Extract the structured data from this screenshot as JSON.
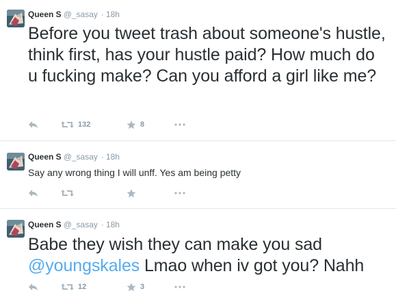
{
  "tweets": [
    {
      "fullname": "Queen S",
      "username": "@_sasay",
      "time": "18h",
      "text_before": "Before you tweet trash about someone's hustle, think first, has your hustle paid? How much do u fucking make? Can you afford a girl like me?",
      "mention": "",
      "text_after": "",
      "retweets": "132",
      "favorites": "8"
    },
    {
      "fullname": "Queen S",
      "username": "@_sasay",
      "time": "18h",
      "text_before": "Say any wrong thing I will unff. Yes am being petty",
      "mention": "",
      "text_after": "",
      "retweets": "",
      "favorites": ""
    },
    {
      "fullname": "Queen S",
      "username": "@_sasay",
      "time": "18h",
      "text_before": "Babe they wish they can make you sad ",
      "mention": "@youngskales",
      "text_after": " Lmao when iv got you? Nahh",
      "retweets": "12",
      "favorites": "3"
    }
  ],
  "icons": {
    "reply": "reply-icon",
    "retweet": "retweet-icon",
    "favorite": "star-icon",
    "more": "more-dots-icon"
  },
  "colors": {
    "text": "#292f33",
    "muted": "#8899a6",
    "action_icon": "#aab8c2",
    "link": "#55acee",
    "divider": "#e1e8ed"
  }
}
